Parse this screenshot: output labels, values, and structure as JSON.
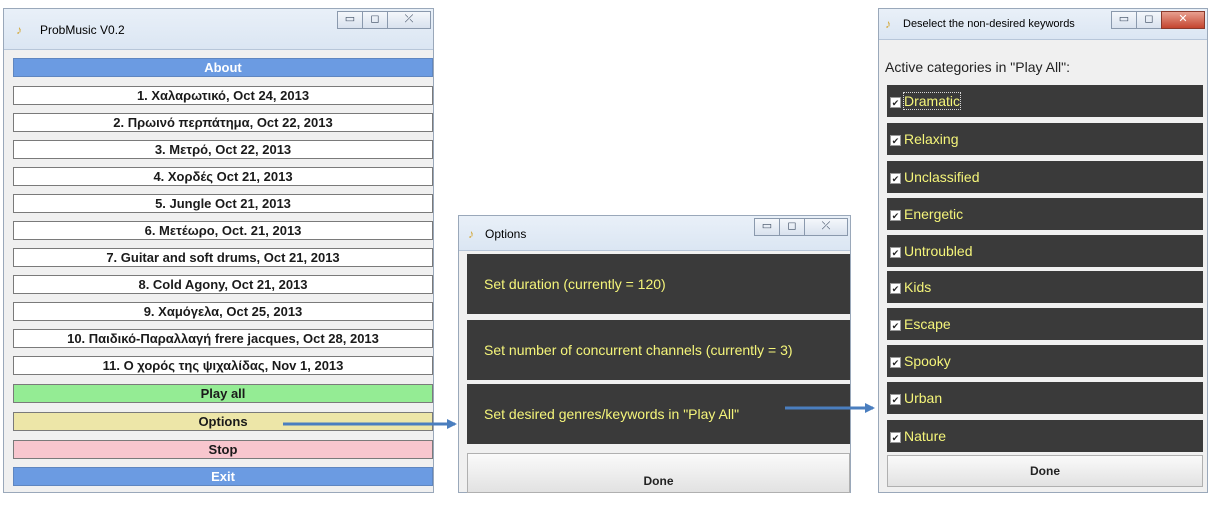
{
  "main_window": {
    "title": "ProbMusic V0.2",
    "app_icon": "music-note-icon",
    "buttons": {
      "minimize": "▭",
      "maximize": "◻",
      "close": "⤫"
    },
    "about_label": "About",
    "songs": [
      "1. Χαλαρωτικό,  Oct 24, 2013",
      "2. Πρωινό περπάτημα,  Oct 22, 2013",
      "3. Μετρό,  Oct 22, 2013",
      "4. Χορδές  Oct 21, 2013",
      "5. Jungle  Oct 21, 2013",
      "6. Μετέωρο, Oct. 21, 2013",
      "7. Guitar and soft drums,  Oct 21, 2013",
      "8. Cold Agony, Oct 21, 2013",
      "9. Χαμόγελα, Oct 25, 2013",
      "10. Παιδικό-Παραλλαγή frere jacques, Oct 28, 2013",
      "11. Ο χορός της ψιχαλίδας, Nov 1, 2013"
    ],
    "play_all_label": "Play all",
    "options_label": "Options",
    "stop_label": "Stop",
    "exit_label": "Exit"
  },
  "options_window": {
    "title": "Options",
    "buttons": {
      "minimize": "▭",
      "maximize": "◻",
      "close": "⤫"
    },
    "panels": [
      "Set duration (currently = 120)",
      "Set number of concurrent channels (currently = 3)",
      "Set desired genres/keywords in \"Play All\""
    ],
    "done_label": "Done"
  },
  "keywords_window": {
    "title": "Deselect the non-desired keywords",
    "buttons": {
      "minimize": "▭",
      "maximize": "◻",
      "close": "✕"
    },
    "heading": "Active categories in \"Play All\":",
    "checkmark": "✔",
    "keywords": [
      "Dramatic",
      "Relaxing",
      "Unclassified",
      "Energetic",
      "Untroubled",
      "Kids",
      "Escape",
      "Spooky",
      "Urban",
      "Nature"
    ],
    "done_label": "Done"
  },
  "colors": {
    "panel_dark": "#3a3a3a",
    "panel_text": "#f5f57a",
    "about_exit_blue": "#6b9be2",
    "play_green": "#94ec94",
    "options_yellow": "#ede6a8",
    "stop_pink": "#f8c6ce",
    "arrow_blue": "#4a7ebf"
  }
}
